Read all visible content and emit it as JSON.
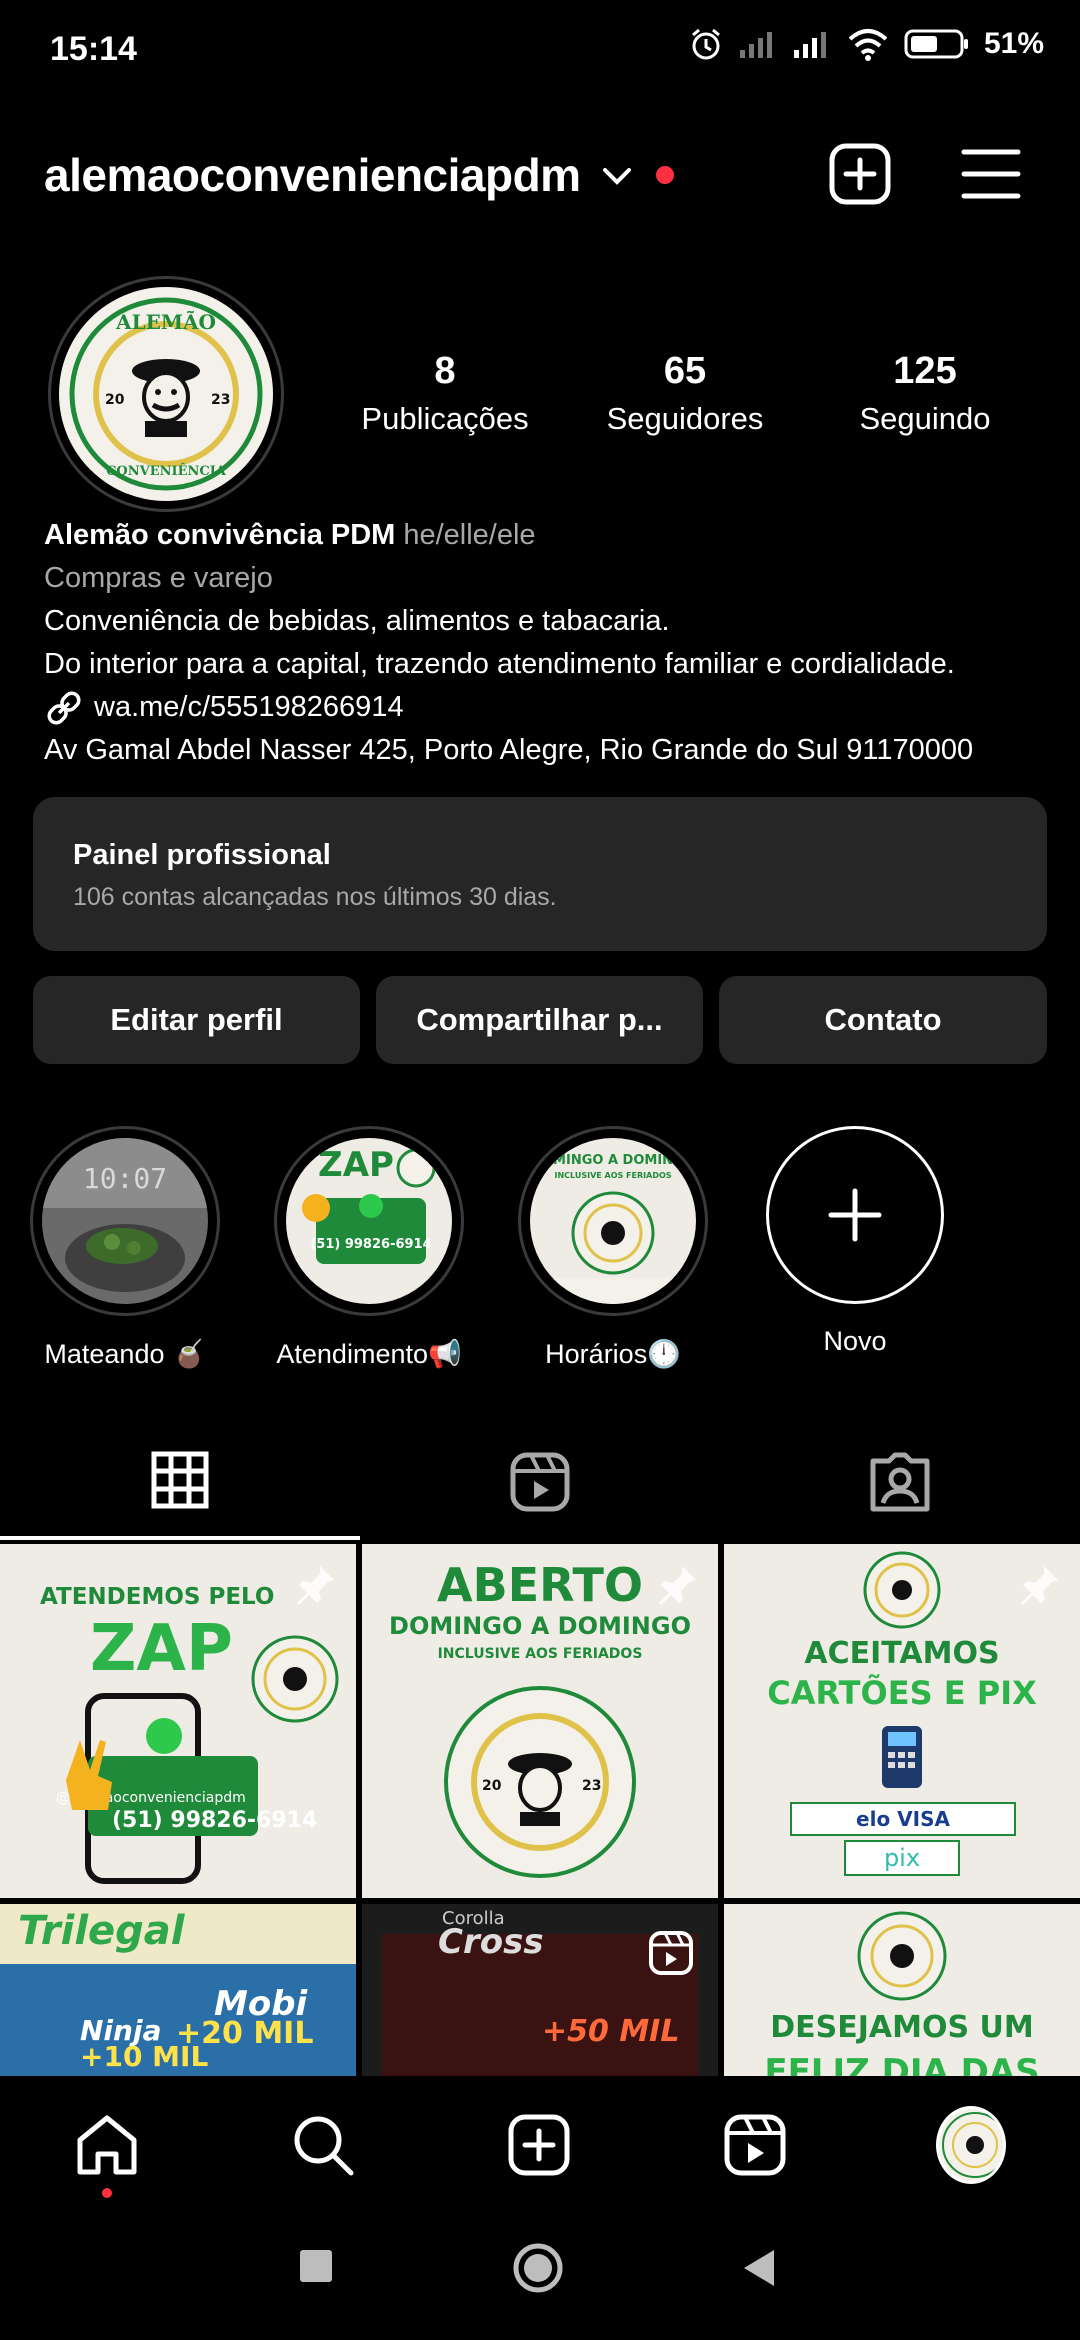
{
  "status_bar": {
    "time": "15:14",
    "battery": "51%"
  },
  "header": {
    "username": "alemaoconvenienciapdm"
  },
  "avatar": {
    "logo_text_top": "ALEMÃO",
    "logo_text_bottom": "CONVENIÊNCIA",
    "year_left": "20",
    "year_right": "23"
  },
  "stats": [
    {
      "value": "8",
      "label": "Publicações"
    },
    {
      "value": "65",
      "label": "Seguidores"
    },
    {
      "value": "125",
      "label": "Seguindo"
    }
  ],
  "bio": {
    "name": "Alemão convivência PDM",
    "pronouns": "he/elle/ele",
    "category": "Compras e varejo",
    "line1": "Conveniência de bebidas, alimentos e tabacaria.",
    "line2": "Do interior para a capital, trazendo atendimento familiar e cordialidade.",
    "link": "wa.me/c/555198266914",
    "address": "Av Gamal Abdel Nasser 425, Porto Alegre, Rio Grande do Sul 91170000"
  },
  "panel": {
    "title": "Painel profissional",
    "subtitle": "106 contas alcançadas nos últimos 30 dias."
  },
  "buttons": {
    "edit": "Editar perfil",
    "share": "Compartilhar p...",
    "contact": "Contato"
  },
  "highlights": [
    {
      "label": "Mateando 🧉",
      "clock": "10:07"
    },
    {
      "label": "Atendimento📢"
    },
    {
      "label": "Horários🕛"
    },
    {
      "label": "Novo"
    }
  ],
  "posts": {
    "p1": {
      "l1": "ATENDEMOS PELO",
      "l2": "ZAP",
      "handle": "@alemaoconvenienciapdm",
      "phone": "(51) 99826-6914"
    },
    "p2": {
      "l1": "ABERTO",
      "l2": "DOMINGO A DOMINGO",
      "l3": "INCLUSIVE AOS FERIADOS"
    },
    "p3": {
      "l1": "ACEITAMOS",
      "l2": "CARTÕES E PIX",
      "cards": "elo VISA",
      "pix": "pix"
    },
    "p4": {
      "l1": "Trilegal",
      "l2": "Mobi",
      "l3": "+20 MIL",
      "l4": "Ninja",
      "l5": "+10 MIL"
    },
    "p5": {
      "l1": "Corolla",
      "l2": "Cross",
      "l3": "+50 MIL"
    },
    "p6": {
      "l1": "DESEJAMOS UM",
      "l2": "FELIZ DIA DAS MÃES!"
    }
  },
  "colors": {
    "accent_green": "#1f8a3a",
    "notification_red": "#ff3040",
    "surface": "#262626"
  }
}
